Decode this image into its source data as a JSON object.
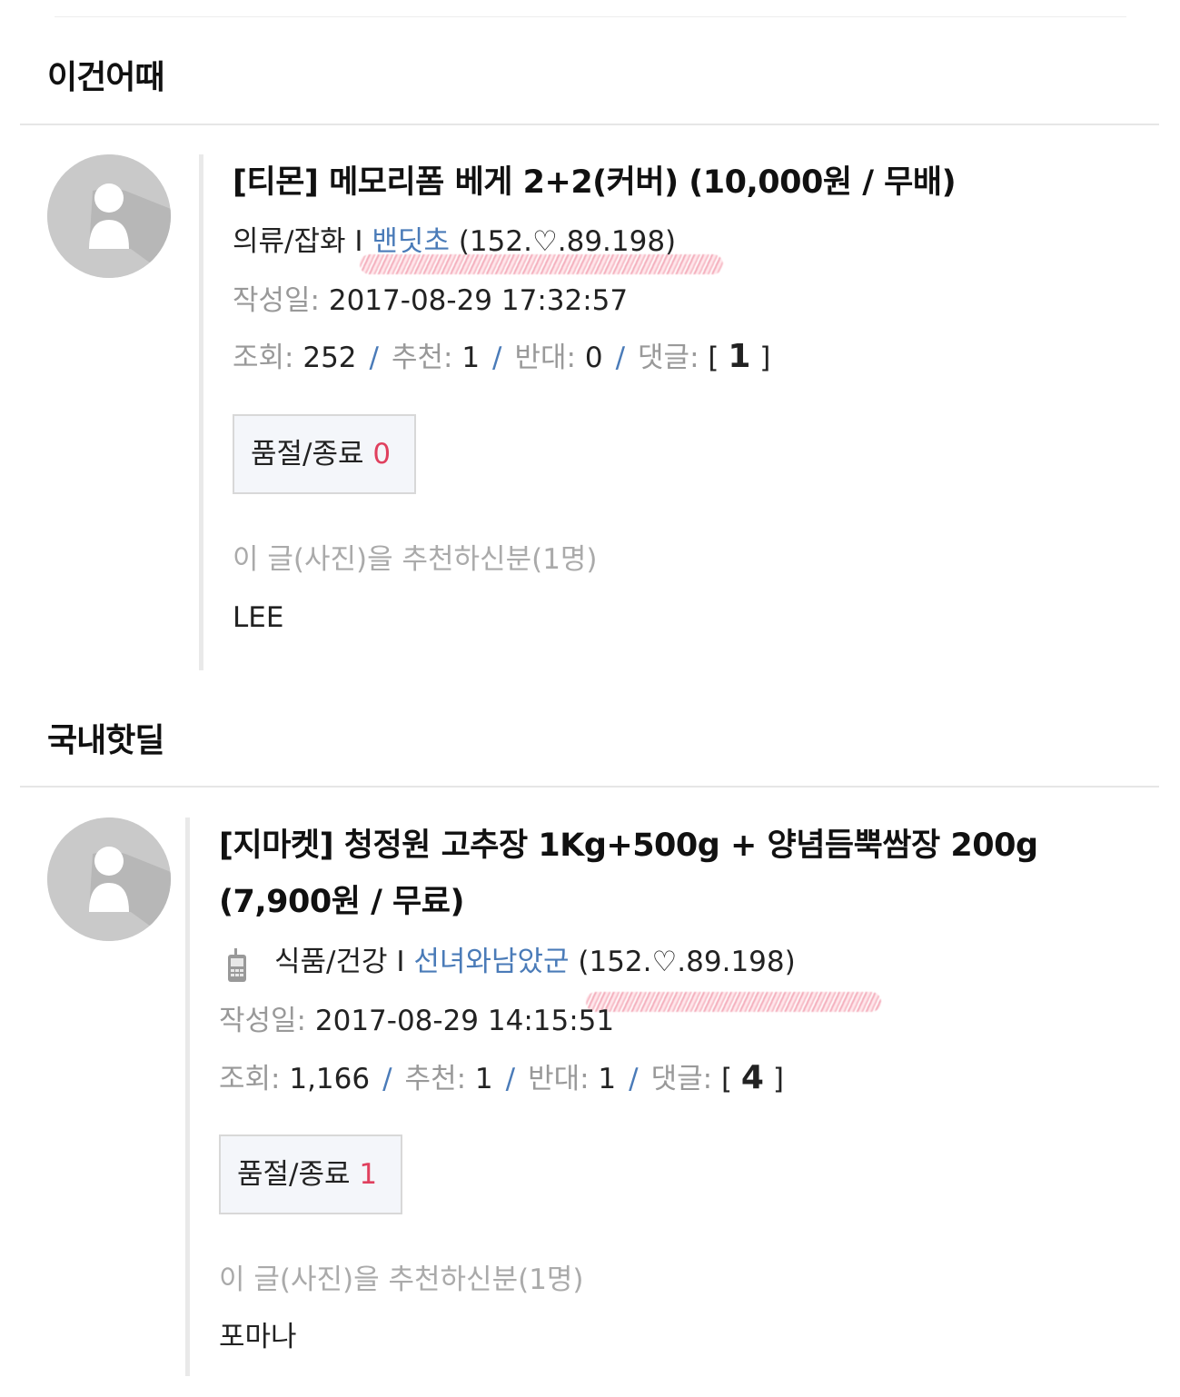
{
  "sections": [
    {
      "title": "이건어때",
      "post": {
        "title_lines": [
          "[티몬] 메모리폼 베게 2+2(커버) (10,000원 / 무배)"
        ],
        "category": "의류/잡화",
        "separator": "I",
        "author": "밴딧초",
        "ip": "(152.♡.89.198)",
        "date_label": "작성일:",
        "date_value": "2017-08-29 17:32:57",
        "views_label": "조회:",
        "views": "252",
        "recommend_label": "추천:",
        "recommend": "1",
        "oppose_label": "반대:",
        "oppose": "0",
        "comments_label": "댓글:",
        "comments_open": "[",
        "comments": "1",
        "comments_close": "]",
        "slash": "/",
        "soldout_label": "품절/종료",
        "soldout_count": "0",
        "recommenders_label": "이 글(사진)을 추천하신분(1명)",
        "recommenders": "LEE"
      }
    },
    {
      "title": "국내핫딜",
      "post": {
        "title_lines": [
          "[지마켓] 청정원 고추장 1Kg+500g + 양념듬뿍쌈장 200g",
          "(7,900원 / 무료)"
        ],
        "category": "식품/건강",
        "separator": "I",
        "author": "선녀와남았군",
        "ip": "(152.♡.89.198)",
        "date_label": "작성일:",
        "date_value": "2017-08-29 14:15:51",
        "views_label": "조회:",
        "views": "1,166",
        "recommend_label": "추천:",
        "recommend": "1",
        "oppose_label": "반대:",
        "oppose": "1",
        "comments_label": "댓글:",
        "comments_open": "[",
        "comments": "4",
        "comments_close": "]",
        "slash": "/",
        "soldout_label": "품절/종료",
        "soldout_count": "1",
        "recommenders_label": "이 글(사진)을 추천하신분(1명)",
        "recommenders": "포마나"
      }
    }
  ],
  "icons": {
    "avatar": "default-user-avatar-icon",
    "mobile": "mobile-phone-icon"
  },
  "colors": {
    "author_link": "#4a7bb8",
    "soldout_count": "#e0405e",
    "label_gray": "#999999"
  }
}
